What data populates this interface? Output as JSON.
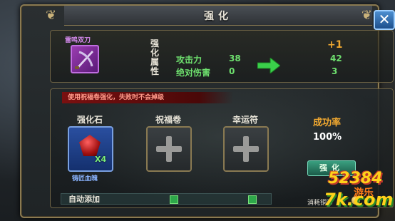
{
  "window": {
    "title": "强化",
    "close_label": "✕"
  },
  "item": {
    "name": "雷鸣双刀",
    "attr_header": "强化属性",
    "level_up": "+1",
    "stats": [
      {
        "name": "攻击力",
        "old": "38",
        "new": "42"
      },
      {
        "name": "绝对伤害",
        "old": "0",
        "new": "3"
      }
    ]
  },
  "enhance": {
    "warning": "使用祝福卷强化，失败时不会掉级",
    "slots": [
      {
        "label": "强化石",
        "count": "X4",
        "item_name": "铸匠血魄"
      },
      {
        "label": "祝福卷"
      },
      {
        "label": "幸运符"
      }
    ],
    "success_rate_label": "成功率",
    "success_rate_value": "100%",
    "enhance_button": "强化",
    "auto_add_label": "自动添加",
    "cost_label": "消耗铜币"
  },
  "watermark": {
    "line1": "52384",
    "line2": "7k.com",
    "side": "游乐"
  },
  "colors": {
    "stat_green": "#6ee06e",
    "level_orange": "#f0a830",
    "warning_red": "#7a1010",
    "close_blue": "#1d4f8c"
  }
}
